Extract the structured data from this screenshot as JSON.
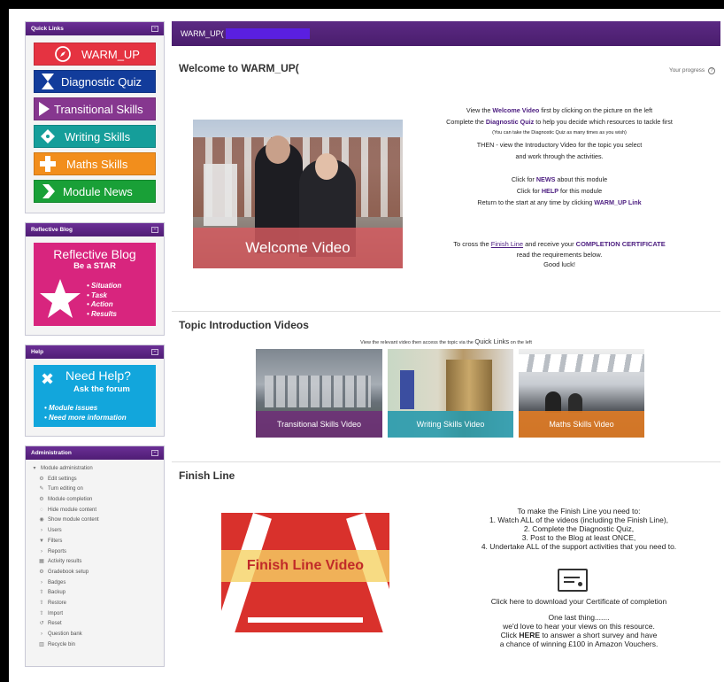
{
  "sidebar": {
    "quick_links": {
      "title": "Quick Links",
      "items": [
        {
          "label": "WARM_UP",
          "icon": "compass-icon"
        },
        {
          "label": "Diagnostic Quiz",
          "icon": "hourglass-icon"
        },
        {
          "label": "Transitional Skills",
          "icon": "play-arrow-icon"
        },
        {
          "label": "Writing Skills",
          "icon": "pen-nib-icon"
        },
        {
          "label": "Maths Skills",
          "icon": "plus-minus-icon"
        },
        {
          "label": "Module News",
          "icon": "chevron-right-icon"
        }
      ]
    },
    "reflective_blog": {
      "title": "Reflective Blog",
      "card_title": "Reflective Blog",
      "card_subtitle": "Be a STAR",
      "star_items": [
        "Situation",
        "Task",
        "Action",
        "Results"
      ]
    },
    "help": {
      "title": "Help",
      "card_title": "Need Help?",
      "card_subtitle": "Ask the forum",
      "items": [
        "Module issues",
        "Need more information"
      ]
    },
    "administration": {
      "title": "Administration",
      "items": [
        {
          "label": "Module administration",
          "icon": "▾",
          "level": 1
        },
        {
          "label": "Edit settings",
          "icon": "⚙",
          "level": 2
        },
        {
          "label": "Turn editing on",
          "icon": "✎",
          "level": 2
        },
        {
          "label": "Module completion",
          "icon": "⚙",
          "level": 2
        },
        {
          "label": "Hide module content",
          "icon": "◌",
          "level": 2
        },
        {
          "label": "Show module content",
          "icon": "◉",
          "level": 2
        },
        {
          "label": "Users",
          "icon": "›",
          "level": 2
        },
        {
          "label": "Filters",
          "icon": "▼",
          "level": 2
        },
        {
          "label": "Reports",
          "icon": "›",
          "level": 2
        },
        {
          "label": "Activity results",
          "icon": "▦",
          "level": 2
        },
        {
          "label": "Gradebook setup",
          "icon": "⚙",
          "level": 2
        },
        {
          "label": "Badges",
          "icon": "›",
          "level": 2
        },
        {
          "label": "Backup",
          "icon": "⇧",
          "level": 2
        },
        {
          "label": "Restore",
          "icon": "⇧",
          "level": 2
        },
        {
          "label": "Import",
          "icon": "⇧",
          "level": 2
        },
        {
          "label": "Reset",
          "icon": "↺",
          "level": 2
        },
        {
          "label": "Question bank",
          "icon": "›",
          "level": 2
        },
        {
          "label": "Recycle bin",
          "icon": "▥",
          "level": 2
        }
      ]
    }
  },
  "main": {
    "breadcrumb_title": "WARM_UP(",
    "welcome": {
      "heading": "Welcome to WARM_UP(",
      "progress_label": "Your progress",
      "video_caption": "Welcome Video",
      "instructions": [
        {
          "pre": "View the ",
          "bold": "Welcome Video",
          "post": " first by clicking on the picture on the left"
        },
        {
          "pre": "Complete the ",
          "bold": "Diagnostic Quiz",
          "post": " to help you decide which resources to tackle first"
        },
        {
          "pre": "(You can take the Diagnostic Quiz as many times as you wish)",
          "bold": "",
          "post": "",
          "small": true
        },
        {
          "pre": "THEN - view the Introductory Video for the topic you select",
          "bold": "",
          "post": ""
        },
        {
          "pre": "and work through the activities.",
          "bold": "",
          "post": ""
        },
        {
          "pre": "",
          "bold": "",
          "post": ""
        },
        {
          "pre": "Click for ",
          "bold": "NEWS",
          "post": " about this module"
        },
        {
          "pre": "Click for ",
          "bold": "HELP",
          "post": " for this module"
        },
        {
          "pre": "Return to the start at any time by clicking ",
          "bold": "WARM_UP Link",
          "post": ""
        }
      ],
      "finish_line_1_pre": "To cross the ",
      "finish_line_1_link": "Finish Line",
      "finish_line_1_mid": " and receive your ",
      "finish_line_1_bold": "COMPLETION CERTIFICATE",
      "finish_line_2": "read the requirements below.",
      "finish_line_3": "Good luck!"
    },
    "topics": {
      "heading": "Topic Introduction Videos",
      "note_pre": "View the relevant video then access the topic via the ",
      "note_big": "Quick Links",
      "note_post": " on the left",
      "videos": [
        {
          "caption": "Transitional Skills Video"
        },
        {
          "caption": "Writing Skills Video"
        },
        {
          "caption": "Maths Skills Video"
        }
      ]
    },
    "finish": {
      "heading": "Finish Line",
      "video_caption": "Finish Line Video",
      "intro": "To make the Finish Line you need to:",
      "steps": [
        "1. Watch ALL of the videos (including the Finish Line),",
        "2. Complete the Diagnostic Quiz,",
        "3. Post to the Blog at least ONCE,",
        "4. Undertake ALL of the support activities that you need to."
      ],
      "certificate_link": "Click here to download your Certificate of completion",
      "one_last": "One last thing.......",
      "views": "we'd love to hear your views on this resource.",
      "survey_pre": "Click ",
      "survey_bold": "HERE",
      "survey_post": " to answer a short survey and have",
      "prize": "a chance of winning £100 in Amazon Vouchers."
    }
  }
}
